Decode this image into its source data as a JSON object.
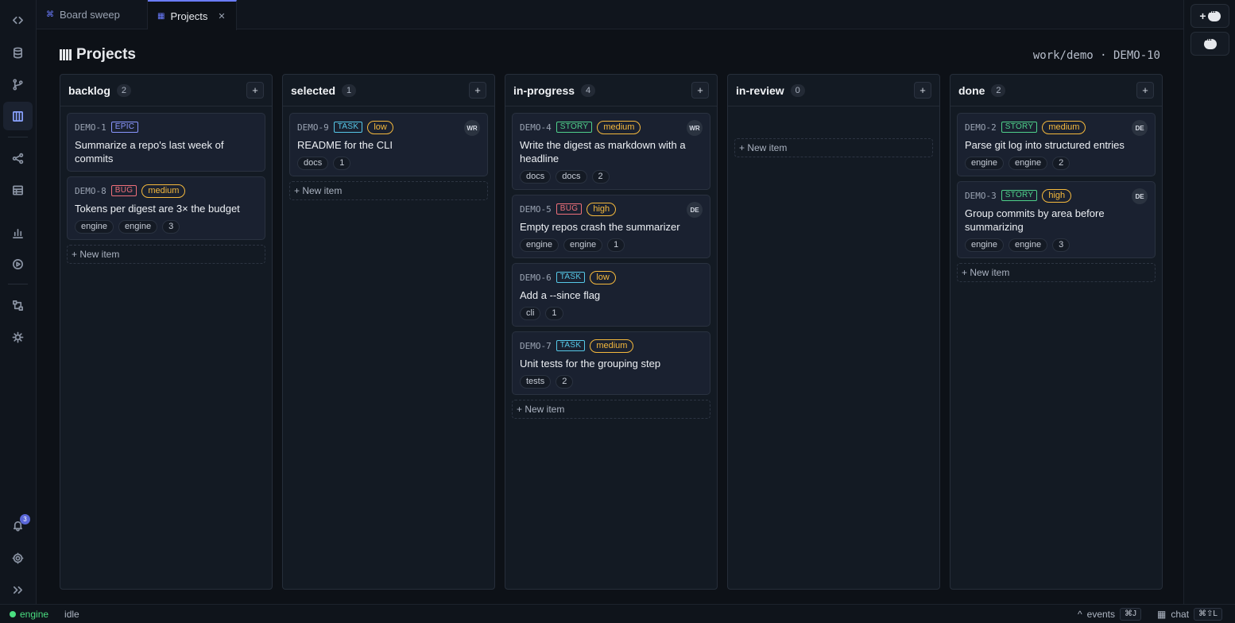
{
  "rail": {
    "notifications_count": "3"
  },
  "tabs": [
    {
      "label": "Board sweep",
      "icon": "⌘"
    },
    {
      "label": "Projects",
      "icon": "▦",
      "close": "✕"
    }
  ],
  "header": {
    "title": "Projects",
    "breadcrumb": "work/demo · DEMO-10"
  },
  "add_label": "+",
  "new_item_label": "+ New item",
  "columns": [
    {
      "name": "backlog",
      "count": "2",
      "cards": [
        {
          "id": "DEMO-1",
          "type": "EPIC",
          "title": "Summarize a repo's last week of commits"
        },
        {
          "id": "DEMO-8",
          "type": "BUG",
          "priority": "medium",
          "title": "Tokens per digest are 3× the budget",
          "tags": [
            "engine",
            "engine",
            "3"
          ]
        }
      ]
    },
    {
      "name": "selected",
      "count": "1",
      "cards": [
        {
          "id": "DEMO-9",
          "type": "TASK",
          "priority": "low",
          "assignee": "WR",
          "title": "README for the CLI",
          "tags": [
            "docs",
            "1"
          ]
        }
      ]
    },
    {
      "name": "in-progress",
      "count": "4",
      "cards": [
        {
          "id": "DEMO-4",
          "type": "STORY",
          "priority": "medium",
          "assignee": "WR",
          "title": "Write the digest as markdown with a headline",
          "tags": [
            "docs",
            "docs",
            "2"
          ]
        },
        {
          "id": "DEMO-5",
          "type": "BUG",
          "priority": "high",
          "assignee": "DE",
          "title": "Empty repos crash the summarizer",
          "tags": [
            "engine",
            "engine",
            "1"
          ]
        },
        {
          "id": "DEMO-6",
          "type": "TASK",
          "priority": "low",
          "title": "Add a --since flag",
          "tags": [
            "cli",
            "1"
          ]
        },
        {
          "id": "DEMO-7",
          "type": "TASK",
          "priority": "medium",
          "title": "Unit tests for the grouping step",
          "tags": [
            "tests",
            "2"
          ]
        }
      ]
    },
    {
      "name": "in-review",
      "count": "0",
      "cards": []
    },
    {
      "name": "done",
      "count": "2",
      "cards": [
        {
          "id": "DEMO-2",
          "type": "STORY",
          "priority": "medium",
          "assignee": "DE",
          "title": "Parse git log into structured entries",
          "tags": [
            "engine",
            "engine",
            "2"
          ]
        },
        {
          "id": "DEMO-3",
          "type": "STORY",
          "priority": "high",
          "assignee": "DE",
          "title": "Group commits by area before summarizing",
          "tags": [
            "engine",
            "engine",
            "3"
          ]
        }
      ]
    }
  ],
  "colors": {
    "EPIC": "#8a96ff",
    "BUG": "#f0707a",
    "TASK": "#56c8e8",
    "STORY": "#4fd18b",
    "priority": "#f5b93d",
    "accent": "#6b7cff"
  },
  "statusbar": {
    "engine": "engine",
    "state": "idle",
    "events_label": "events",
    "events_kbd": "⌘J",
    "chat_label": "chat",
    "chat_kbd": "⌘⇧L"
  }
}
